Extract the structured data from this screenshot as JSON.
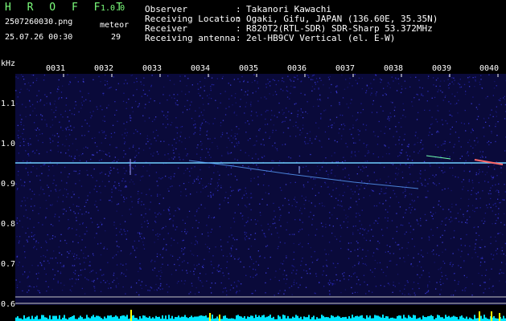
{
  "header": {
    "app_name": "H R O F F T",
    "version": "1.0.0",
    "filename": "2507260030.png",
    "meteor_label": "meteor",
    "datetime": "25.07.26 00:30",
    "meteor_count": "29",
    "info": [
      {
        "label": "Observer",
        "sep": ":",
        "value": "Takanori Kawachi"
      },
      {
        "label": "Receiving Location",
        "sep": ":",
        "value": "Ogaki, Gifu, JAPAN (136.60E, 35.35N)"
      },
      {
        "label": "Receiver",
        "sep": ":",
        "value": "R820T2(RTL-SDR) SDR-Sharp 53.372MHz"
      },
      {
        "label": "Receiving antenna",
        "sep": ":",
        "value": "2el-HB9CV Vertical (el. E-W)"
      }
    ]
  },
  "axis": {
    "y_unit": "kHz",
    "y_ticks": [
      "1.1",
      "1.0",
      "0.9",
      "0.8",
      "0.7",
      "0.6"
    ],
    "x_ticks": [
      "0031",
      "0032",
      "0033",
      "0034",
      "0035",
      "0036",
      "0037",
      "0038",
      "0039",
      "0040"
    ]
  },
  "colors": {
    "background": "#000000",
    "spectrogram_noise": "#1c1c8c",
    "carrier_line": "#6fd0ff",
    "level_bar": "#00e5ff",
    "level_peak": "#ffff00",
    "text_green": "#7cff7c",
    "text_white": "#ffffff"
  }
}
